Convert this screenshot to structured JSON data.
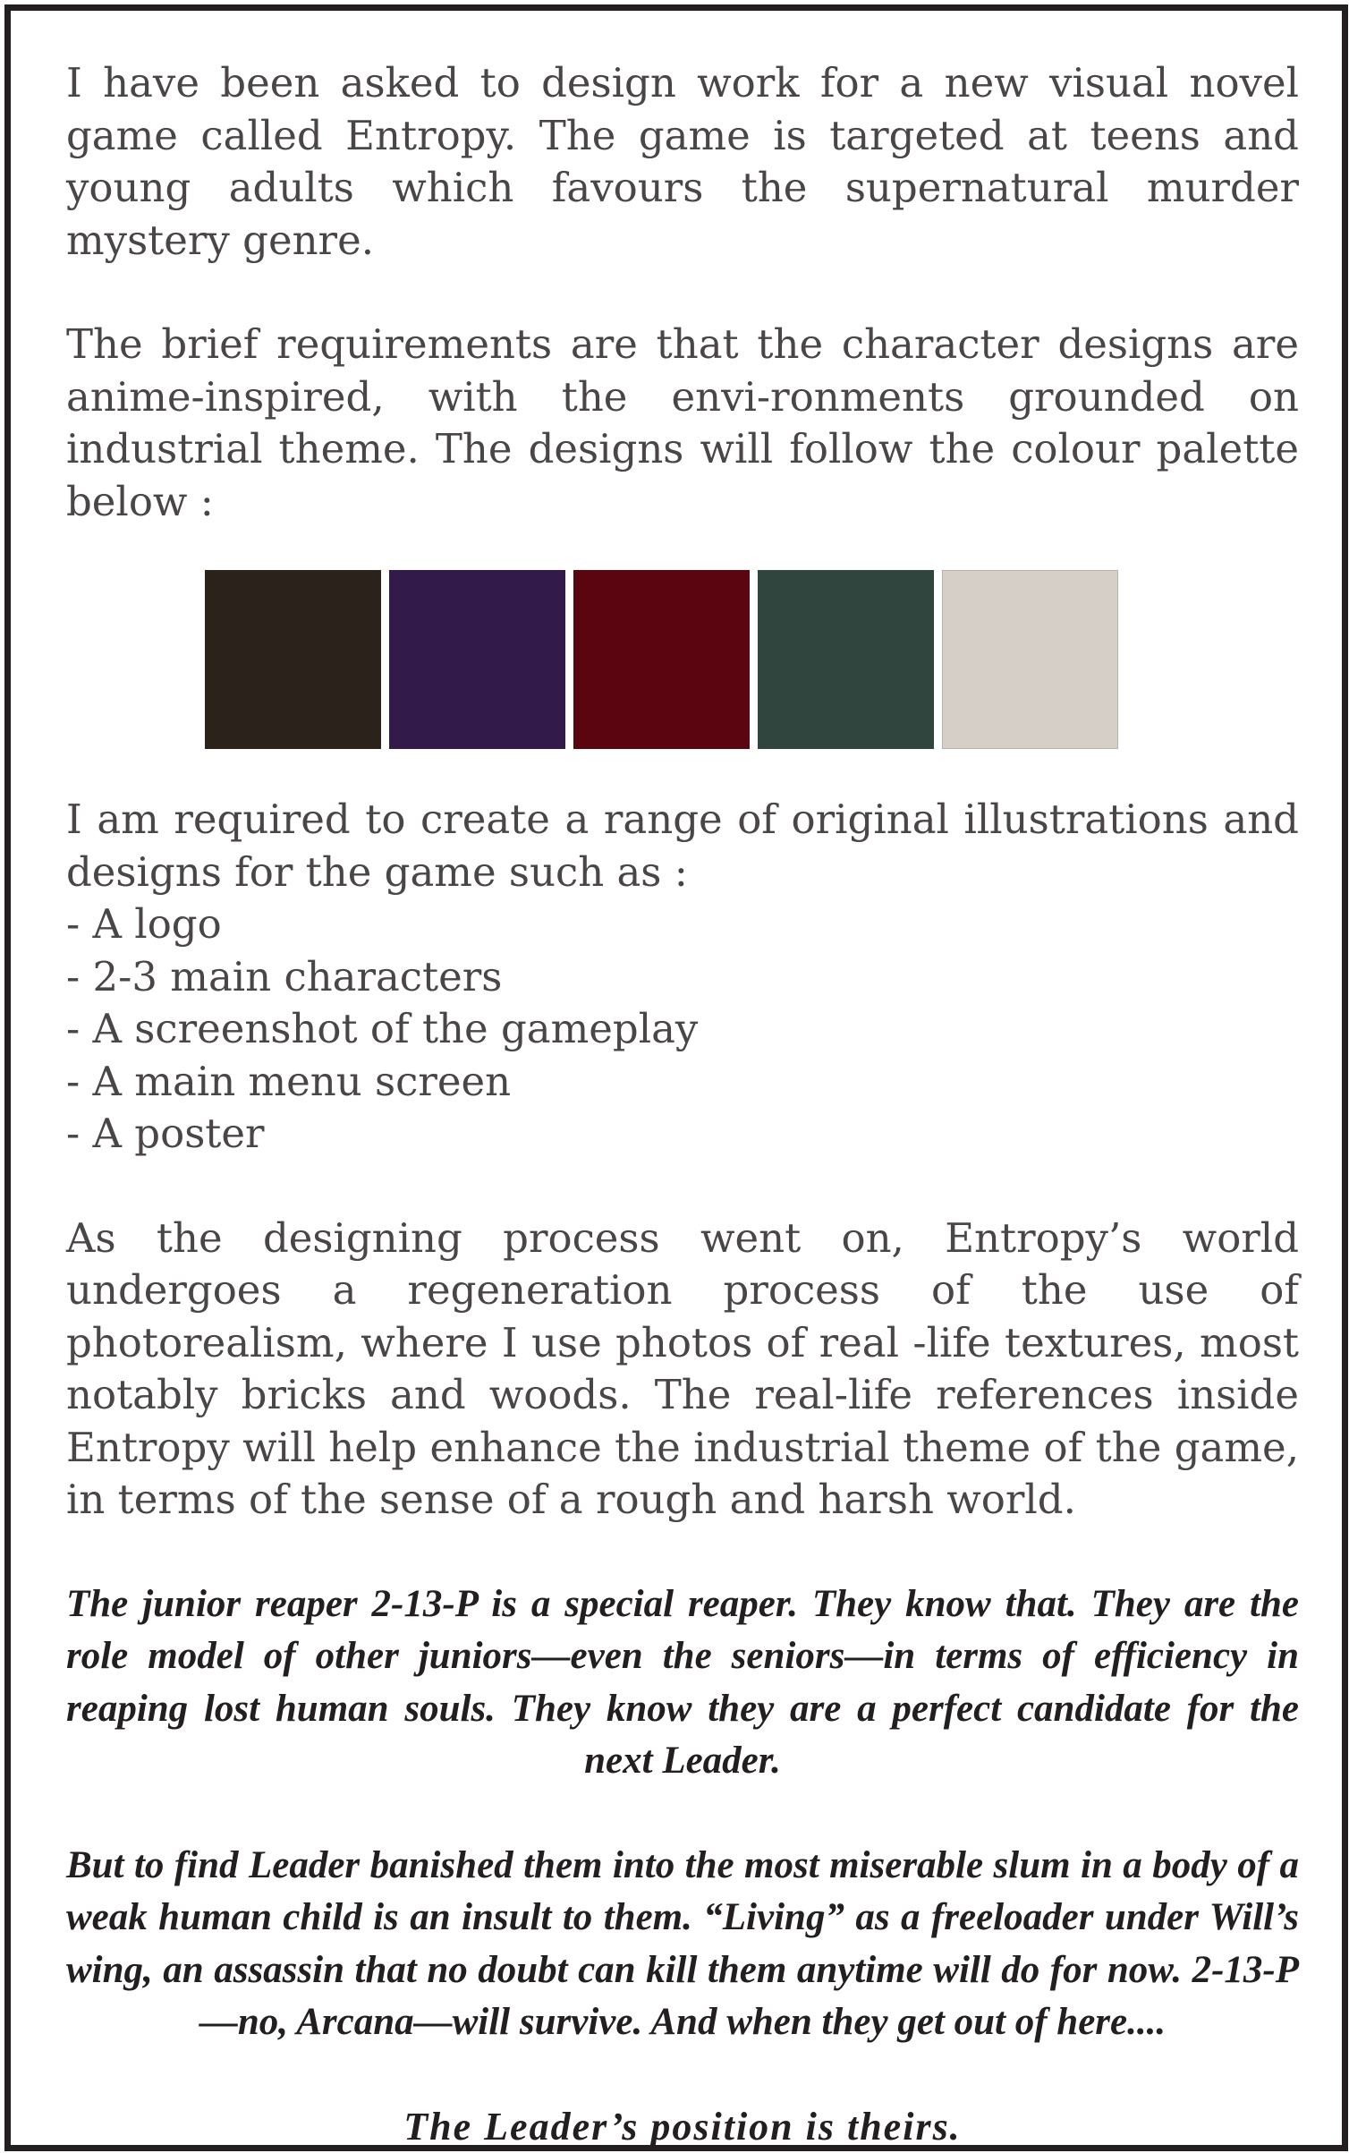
{
  "intro": {
    "paragraph1": "I have been asked to design work for a new visual novel game called Entropy. The game is targeted at teens and young adults which favours the supernatural murder mystery genre.",
    "paragraph2": "The brief requirements are that the character designs are anime-inspired, with the envi-ronments grounded on industrial theme. The designs will follow the colour palette below :"
  },
  "palette": [
    {
      "color": "#2b221b"
    },
    {
      "color": "#321a4a"
    },
    {
      "color": "#5a0510"
    },
    {
      "color": "#30453d"
    },
    {
      "color": "#d6cfc7"
    }
  ],
  "requirements": {
    "heading": "I am required to create a range of original illustrations and designs for the game such as :",
    "items": [
      "- A logo",
      "- 2-3 main characters",
      "- A screenshot of the gameplay",
      "- A main menu screen",
      "- A poster"
    ]
  },
  "process": {
    "paragraph": "As the designing process went on, Entropy’s world undergoes a regeneration process of the use of photorealism, where I use photos of real -life textures, most notably bricks and woods. The real-life references inside Entropy will help enhance the industrial theme of the game, in terms of the sense of a rough and harsh world."
  },
  "story": {
    "paragraph1": "The junior reaper 2-13-P is a special reaper. They know that. They are the role model of other juniors—even the seniors—in terms of efficiency in reaping lost human souls. They know they are a perfect candidate for the next Leader.",
    "paragraph2": "But to find Leader banished them into the most miserable slum in a body of a weak human child is an insult to them. “Living” as a freeloader under Will’s wing, an assassin that no doubt can kill them anytime will do for now. 2-13-P—no, Arcana—will survive. And when they get out of here....",
    "closing": "The Leader’s position is theirs."
  }
}
